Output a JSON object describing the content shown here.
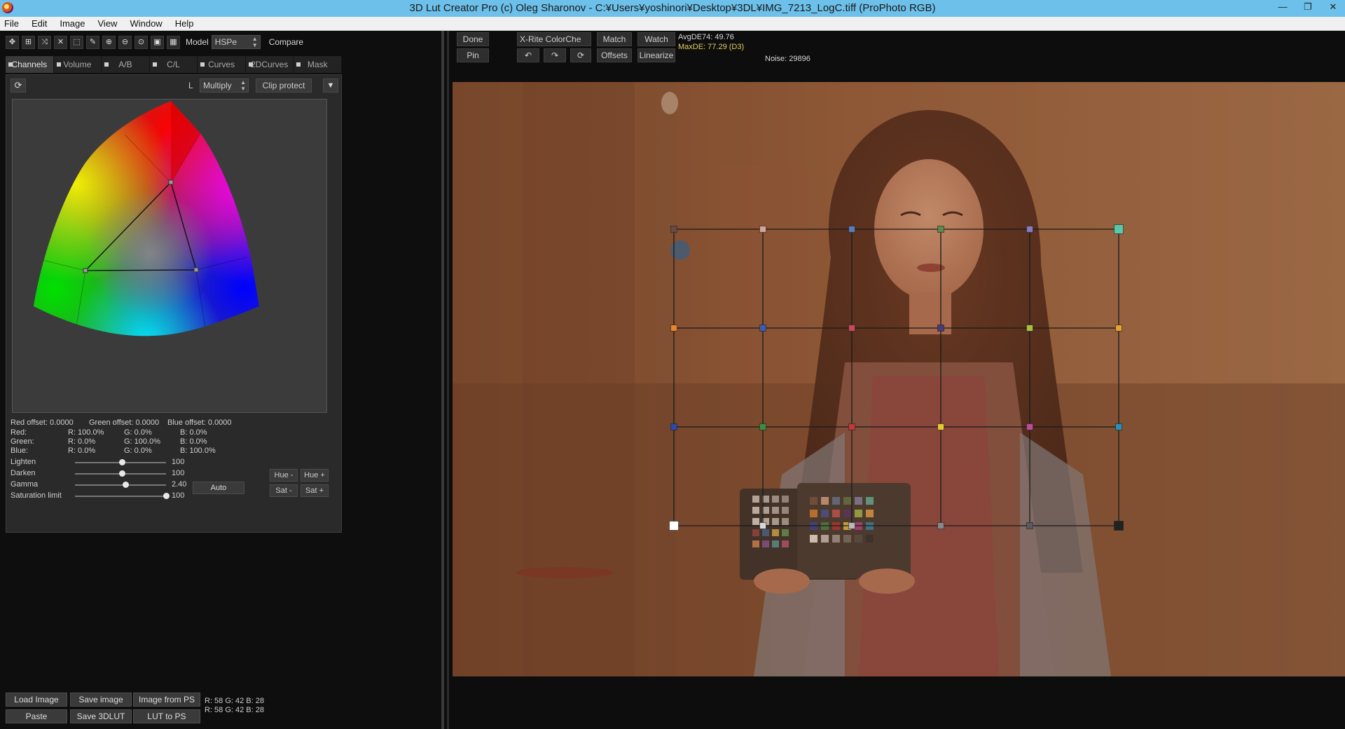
{
  "window": {
    "title": "3D Lut Creator Pro (c) Oleg Sharonov - C:¥Users¥yoshinori¥Desktop¥3DL¥IMG_7213_LogC.tiff (ProPhoto RGB)",
    "buttons": [
      "—",
      "❐",
      "✕"
    ]
  },
  "menu": [
    "File",
    "Edit",
    "Image",
    "View",
    "Window",
    "Help"
  ],
  "toolbar": {
    "model_label": "Model",
    "model_value": "HSPe",
    "compare_label": "Compare"
  },
  "tabs": [
    {
      "label": "Channels",
      "active": true
    },
    {
      "label": "Volume",
      "active": false
    },
    {
      "label": "A/B",
      "active": false
    },
    {
      "label": "C/L",
      "active": false
    },
    {
      "label": "Curves",
      "active": false
    },
    {
      "label": "2DCurves",
      "active": false
    },
    {
      "label": "Mask",
      "active": false
    }
  ],
  "channels": {
    "l_label": "L",
    "blend_mode": "Multiply",
    "clip_protect": "Clip protect",
    "offsets": {
      "red": "Red offset: 0.0000",
      "green": "Green offset: 0.0000",
      "blue": "Blue offset: 0.0000"
    },
    "matrix": [
      {
        "name": "Red:",
        "r": "R: 100.0%",
        "g": "G: 0.0%",
        "b": "B: 0.0%"
      },
      {
        "name": "Green:",
        "r": "R: 0.0%",
        "g": "G: 100.0%",
        "b": "B: 0.0%"
      },
      {
        "name": "Blue:",
        "r": "R: 0.0%",
        "g": "G: 0.0%",
        "b": "B: 100.0%"
      }
    ],
    "sliders": [
      {
        "label": "Lighten",
        "value": "100",
        "pos": 0.5
      },
      {
        "label": "Darken",
        "value": "100",
        "pos": 0.5
      },
      {
        "label": "Gamma",
        "value": "2.40",
        "pos": 0.54
      },
      {
        "label": "Saturation limit",
        "value": "100",
        "pos": 1.0
      }
    ],
    "auto": "Auto",
    "hue_minus": "Hue -",
    "hue_plus": "Hue +",
    "sat_minus": "Sat -",
    "sat_plus": "Sat +"
  },
  "bottom_buttons": {
    "load_image": "Load Image",
    "save_image": "Save image",
    "image_from_ps": "Image from PS",
    "paste": "Paste",
    "save_3dlut": "Save 3DLUT",
    "lut_to_ps": "LUT to PS"
  },
  "readout": {
    "line1": "R:  58   G:  42   B:  28",
    "line2": "R:  58   G:  42   B:  28"
  },
  "right_toolbar": {
    "done": "Done",
    "pin": "Pin",
    "chart": "X-Rite ColorChe",
    "match": "Match",
    "watch": "Watch",
    "offsets": "Offsets",
    "linearize": "Linearize",
    "avg_de": "AvgDE74: 49.76",
    "max_de": "MaxDE: 77.29 (D3)",
    "noise": "Noise: 29896"
  },
  "colors": {
    "max_de_text": "#e3cf5a",
    "titlebar": "#6cc0ea",
    "grid_points": [
      [
        "#6a4a45",
        "#d8a49a",
        "#5a7ab8",
        "#5b8a4a",
        "#8a7ab8",
        "#5ac8a8"
      ],
      [
        "#e8852a",
        "#3a5cb8",
        "#c84a5a",
        "#4a3a7a",
        "#a8c040",
        "#e8a030"
      ],
      [
        "#2a4ab0",
        "#3a9040",
        "#c03a3a",
        "#e8c830",
        "#c04a9a",
        "#2a90b8"
      ],
      [
        "#ffffff",
        "#d8d8d8",
        "#b8b8b8",
        "#888888",
        "#5a5a5a",
        "#222222"
      ]
    ]
  }
}
